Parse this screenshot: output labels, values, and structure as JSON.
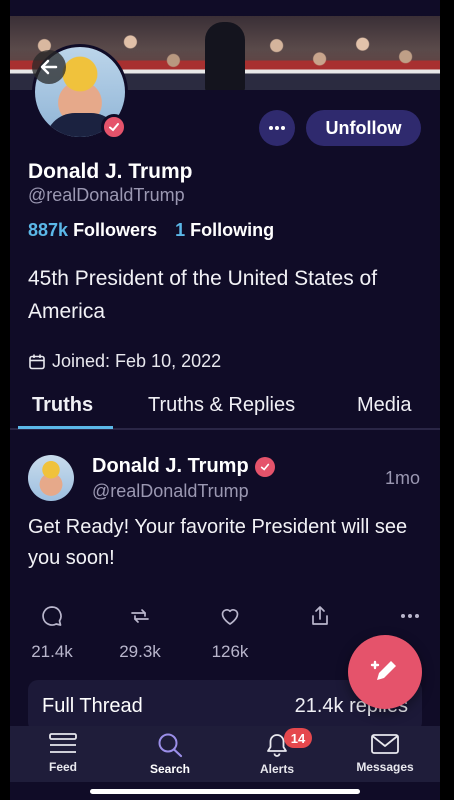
{
  "profile": {
    "name": "Donald J. Trump",
    "handle": "@realDonaldTrump",
    "followers_count": "887k",
    "followers_label": "Followers",
    "following_count": "1",
    "following_label": "Following",
    "bio": "45th President of the United States of America",
    "joined": "Joined: Feb 10, 2022",
    "unfollow_label": "Unfollow"
  },
  "tabs": [
    {
      "label": "Truths",
      "active": true
    },
    {
      "label": "Truths & Replies",
      "active": false
    },
    {
      "label": "Media",
      "active": false
    }
  ],
  "post": {
    "name": "Donald J. Trump",
    "handle": "@realDonaldTrump",
    "time": "1mo",
    "text": "Get Ready! Your favorite President will see you soon!",
    "replies": "21.4k",
    "retruths": "29.3k",
    "likes": "126k",
    "thread_label": "Full Thread",
    "thread_replies": "21.4k replies"
  },
  "nav": [
    {
      "label": "Feed",
      "icon": "feed-icon",
      "active": false
    },
    {
      "label": "Search",
      "icon": "search-icon",
      "active": true
    },
    {
      "label": "Alerts",
      "icon": "bell-icon",
      "active": false,
      "badge": "14"
    },
    {
      "label": "Messages",
      "icon": "mail-icon",
      "active": false
    }
  ],
  "colors": {
    "background": "#100c27",
    "accent_blue": "#5bb8e8",
    "brand_pink": "#e5536b",
    "button_purple": "#2f2a6e",
    "active_nav": "#9b8ee8"
  }
}
